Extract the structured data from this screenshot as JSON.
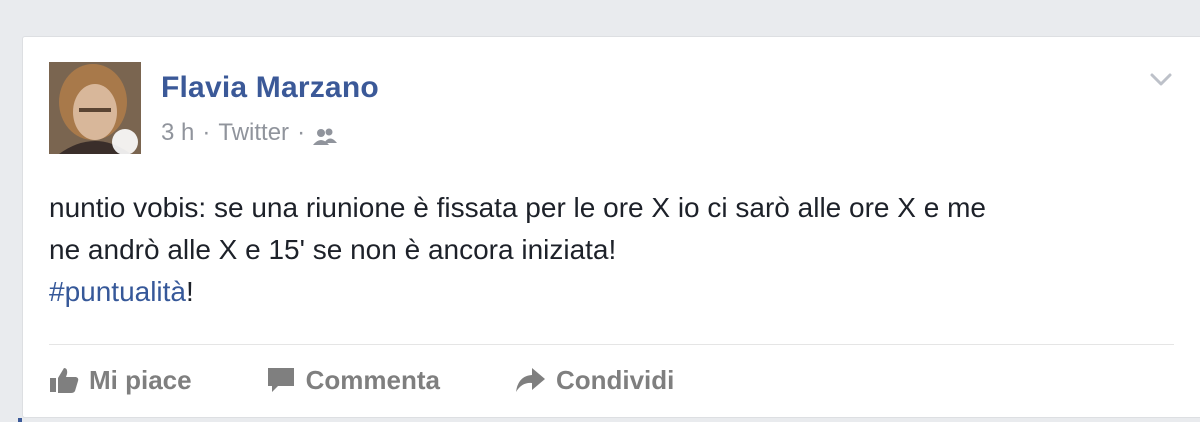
{
  "post": {
    "author": "Flavia Marzano",
    "timestamp": "3 h",
    "source": "Twitter",
    "separator": "·",
    "audience_icon": "friends-icon",
    "text_line1": "nuntio vobis: se una riunione è fissata per le ore X io ci sarò alle ore X e me",
    "text_line2": "ne andrò alle X e 15' se non è ancora iniziata!",
    "hashtag": "#puntualità",
    "hashtag_suffix": "!"
  },
  "actions": {
    "like_label": "Mi piace",
    "comment_label": "Commenta",
    "share_label": "Condividi"
  },
  "colors": {
    "author": "#3b5998",
    "link": "#365899",
    "meta": "#90949c",
    "action": "#7f7f7f",
    "background": "#e9ebee"
  }
}
